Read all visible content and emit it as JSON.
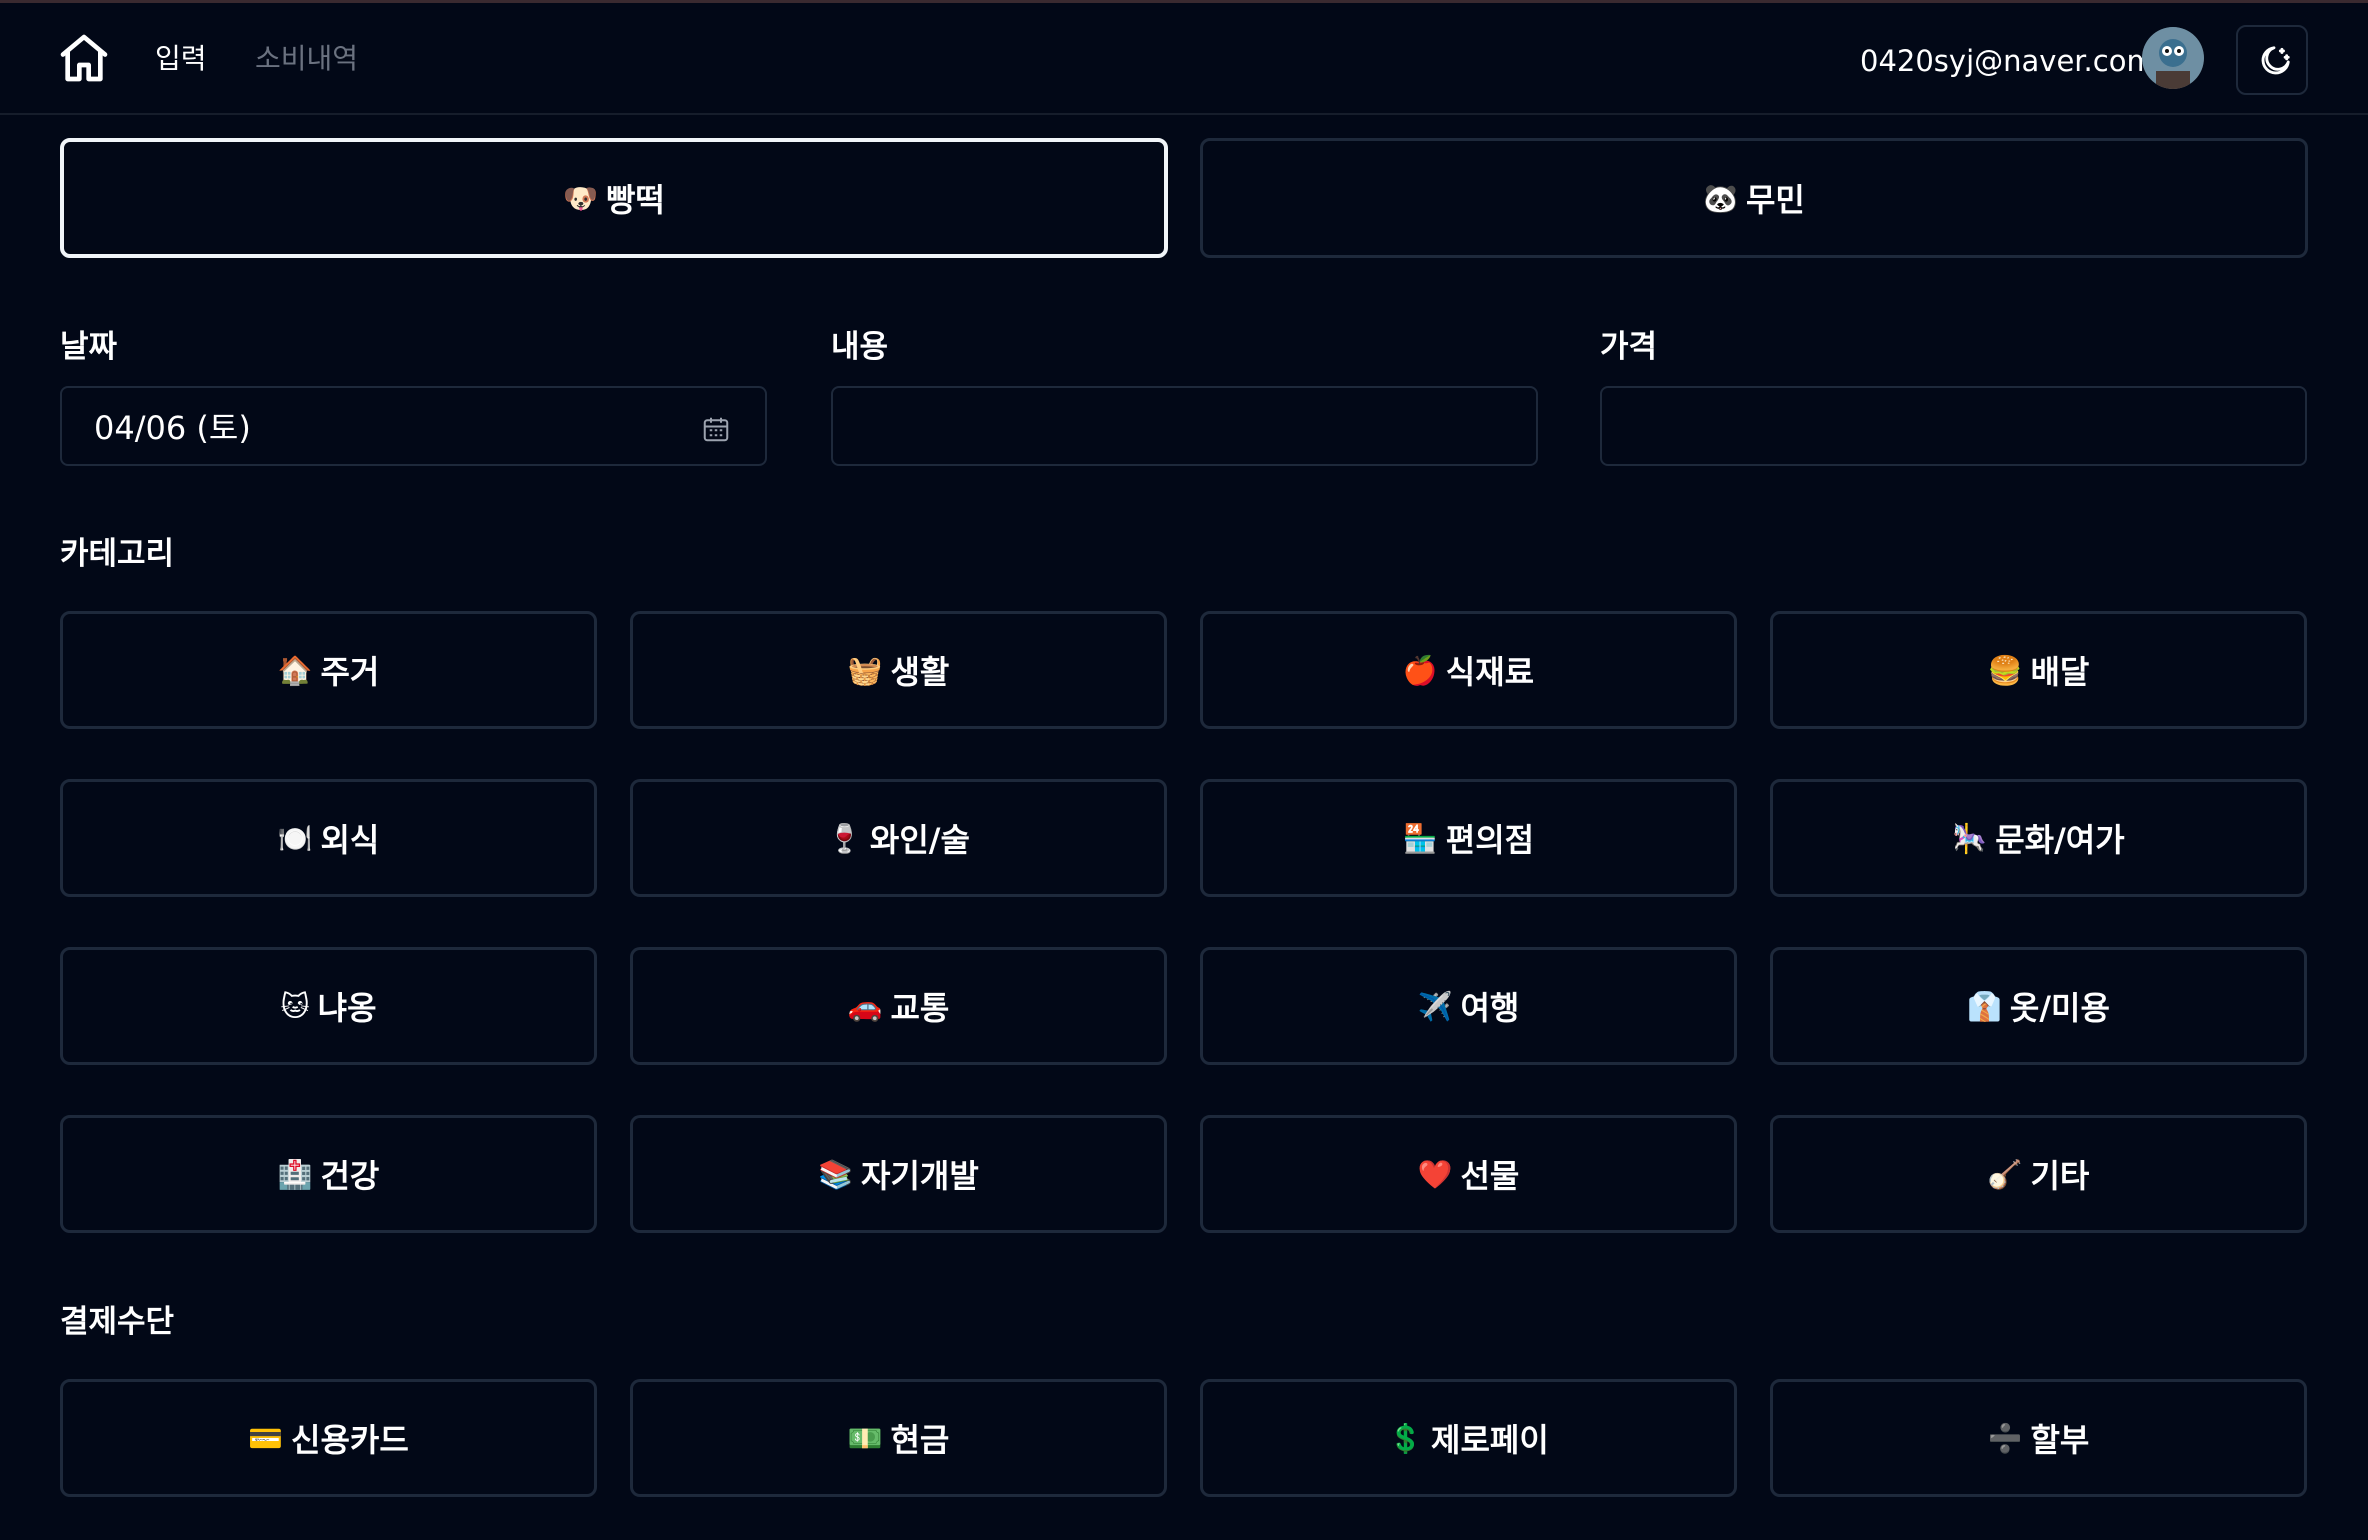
{
  "nav": {
    "input_label": "입력",
    "history_label": "소비내역",
    "user_email": "0420syj@naver.com"
  },
  "owners": [
    {
      "emoji": "🐶",
      "label": "빵떡",
      "selected": true
    },
    {
      "emoji": "🐼",
      "label": "무민",
      "selected": false
    }
  ],
  "form": {
    "date_label": "날짜",
    "date_value": "04/06 (토)",
    "content_label": "내용",
    "content_value": "",
    "price_label": "가격",
    "price_value": ""
  },
  "category_title": "카테고리",
  "categories": [
    {
      "emoji": "🏠",
      "label": "주거"
    },
    {
      "emoji": "🧺",
      "label": "생활"
    },
    {
      "emoji": "🍎",
      "label": "식재료"
    },
    {
      "emoji": "🍔",
      "label": "배달"
    },
    {
      "emoji": "🍽️",
      "label": "외식"
    },
    {
      "emoji": "🍷",
      "label": "와인/술"
    },
    {
      "emoji": "🏪",
      "label": "편의점"
    },
    {
      "emoji": "🎠",
      "label": "문화/여가"
    },
    {
      "emoji": "🐱",
      "label": "냐옹"
    },
    {
      "emoji": "🚗",
      "label": "교통"
    },
    {
      "emoji": "✈️",
      "label": "여행"
    },
    {
      "emoji": "👔",
      "label": "옷/미용"
    },
    {
      "emoji": "🏥",
      "label": "건강"
    },
    {
      "emoji": "📚",
      "label": "자기개발"
    },
    {
      "emoji": "❤️",
      "label": "선물"
    },
    {
      "emoji": "🪕",
      "label": "기타"
    }
  ],
  "payment_title": "결제수단",
  "payments": [
    {
      "emoji": "💳",
      "label": "신용카드"
    },
    {
      "emoji": "💵",
      "label": "현금"
    },
    {
      "emoji": "💲",
      "label": "제로페이"
    },
    {
      "emoji": "➗",
      "label": "할부"
    }
  ]
}
